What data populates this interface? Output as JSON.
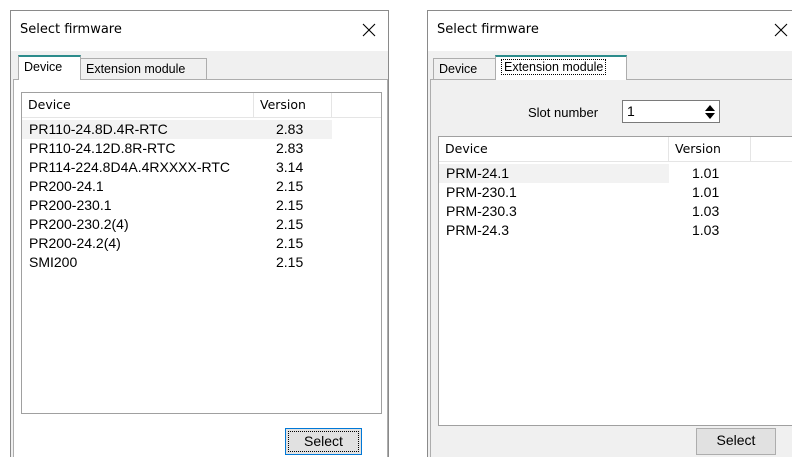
{
  "left_dialog": {
    "title": "Select firmware",
    "tabs": [
      "Device",
      "Extension module"
    ],
    "columns": [
      "Device",
      "Version"
    ],
    "rows": [
      {
        "device": "PR110-24.8D.4R-RTC",
        "version": "2.83"
      },
      {
        "device": "PR110-24.12D.8R-RTC",
        "version": "2.83"
      },
      {
        "device": "PR114-224.8D4A.4RXXXX-RTC",
        "version": "3.14"
      },
      {
        "device": "PR200-24.1",
        "version": "2.15"
      },
      {
        "device": "PR200-230.1",
        "version": "2.15"
      },
      {
        "device": "PR200-230.2(4)",
        "version": "2.15"
      },
      {
        "device": "PR200-24.2(4)",
        "version": "2.15"
      },
      {
        "device": "SMI200",
        "version": "2.15"
      }
    ],
    "select_label": "Select"
  },
  "right_dialog": {
    "title": "Select firmware",
    "tabs": [
      "Device",
      "Extension module"
    ],
    "slot_label": "Slot number",
    "slot_value": "1",
    "columns": [
      "Device",
      "Version"
    ],
    "rows": [
      {
        "device": "PRM-24.1",
        "version": "1.01"
      },
      {
        "device": "PRM-230.1",
        "version": "1.01"
      },
      {
        "device": "PRM-230.3",
        "version": "1.03"
      },
      {
        "device": "PRM-24.3",
        "version": "1.03"
      }
    ],
    "select_label": "Select"
  },
  "colors": {
    "tab_accent": "#2c8c8c",
    "dialog_bg": "#f0f0f0",
    "default_button_border": "#0078d7"
  },
  "icons": {
    "close": "close-icon",
    "spinner": "spinner-arrows-icon"
  }
}
